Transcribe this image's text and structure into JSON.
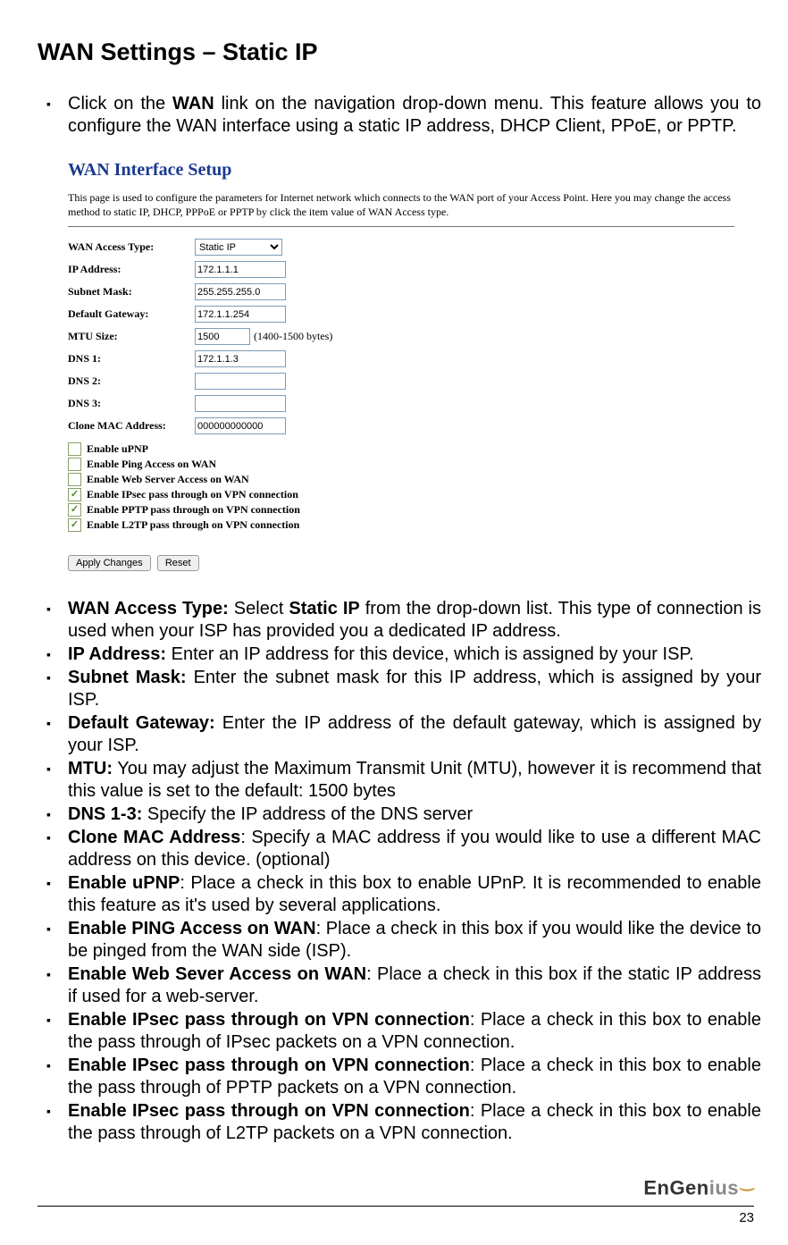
{
  "title": "WAN Settings – Static IP",
  "intro": {
    "pre": "Click on the ",
    "link": "WAN",
    "post": " link on the navigation drop-down menu. This feature allows you to configure the WAN interface using a static IP address, DHCP Client, PPoE, or PPTP."
  },
  "screenshot": {
    "title": "WAN Interface Setup",
    "desc": "This page is used to configure the parameters for Internet network which connects to the WAN port of your Access Point. Here you may change the access method to static IP, DHCP, PPPoE or PPTP by click the item value of WAN Access type.",
    "labels": {
      "access": "WAN Access Type:",
      "ip": "IP Address:",
      "subnet": "Subnet Mask:",
      "gateway": "Default Gateway:",
      "mtu": "MTU Size:",
      "dns1": "DNS 1:",
      "dns2": "DNS 2:",
      "dns3": "DNS 3:",
      "clone": "Clone MAC Address:"
    },
    "values": {
      "access": "Static IP",
      "ip": "172.1.1.1",
      "subnet": "255.255.255.0",
      "gateway": "172.1.1.254",
      "mtu": "1500",
      "mtu_hint": "(1400-1500 bytes)",
      "dns1": "172.1.1.3",
      "dns2": "",
      "dns3": "",
      "clone": "000000000000"
    },
    "checkboxes": [
      {
        "label": "Enable uPNP",
        "checked": false
      },
      {
        "label": "Enable Ping Access on WAN",
        "checked": false
      },
      {
        "label": "Enable Web Server Access on WAN",
        "checked": false
      },
      {
        "label": "Enable IPsec pass through on VPN connection",
        "checked": true
      },
      {
        "label": "Enable PPTP pass through on VPN connection",
        "checked": true
      },
      {
        "label": "Enable L2TP pass through on VPN connection",
        "checked": true
      }
    ],
    "buttons": {
      "apply": "Apply Changes",
      "reset": "Reset"
    }
  },
  "descriptions": [
    {
      "b": "WAN Access Type:",
      "t": " Select ",
      "b2": "Static IP",
      "t2": " from the drop-down list. This type of connection is used when your ISP has provided you a dedicated IP address."
    },
    {
      "b": "IP Address:",
      "t": " Enter an IP address for this device, which is assigned by your ISP."
    },
    {
      "b": "Subnet Mask:",
      "t": " Enter the subnet mask for this IP address, which is assigned by your ISP."
    },
    {
      "b": "Default Gateway:",
      "t": " Enter the IP address of the default gateway, which is assigned by your ISP."
    },
    {
      "b": "MTU:",
      "t": " You may adjust the Maximum Transmit Unit (MTU), however it is recommend that this value is set to the default: 1500 bytes"
    },
    {
      "b": "DNS 1-3:",
      "t": " Specify the IP address of the DNS server"
    },
    {
      "b": "Clone MAC Address",
      "t": ": Specify a MAC address if you would like to use a different MAC address on this device. (optional)"
    },
    {
      "b": "Enable uPNP",
      "t": ": Place a check in this box to enable UPnP. It is recommended to enable this feature as it's used by several applications."
    },
    {
      "b": "Enable PING Access on WAN",
      "t": ": Place a check in this box if you would like the device to be pinged from the WAN side (ISP)."
    },
    {
      "b": "Enable Web Sever Access on WAN",
      "t": ": Place a check in this box if the static IP address if used for a web-server."
    },
    {
      "b": "Enable IPsec pass through on VPN connection",
      "t": ": Place a check in this box to enable the pass through of IPsec packets on a VPN connection."
    },
    {
      "b": "Enable IPsec pass through on VPN connection",
      "t": ": Place a check in this box to enable the pass through of PPTP packets on a VPN connection."
    },
    {
      "b": "Enable IPsec pass through on VPN connection",
      "t": ": Place a check in this box to enable the pass through of L2TP packets on a VPN connection."
    }
  ],
  "footer": {
    "logo_a": "EnGen",
    "logo_b": "ius",
    "page": "23"
  }
}
